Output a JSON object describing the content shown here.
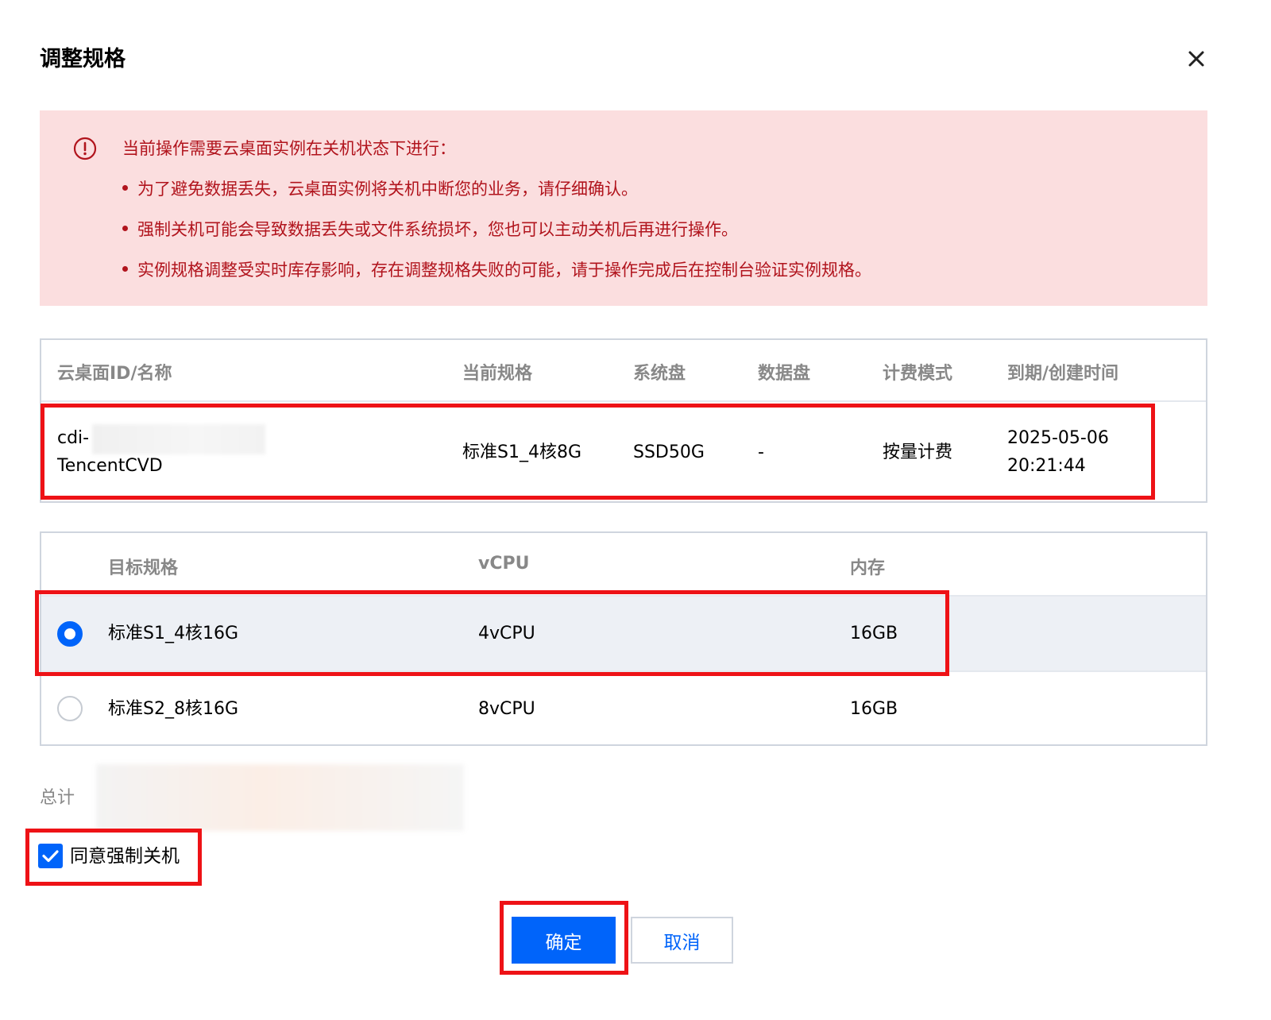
{
  "dialog": {
    "title": "调整规格",
    "close_icon": "close-icon"
  },
  "alert": {
    "color": "#b1141d",
    "background": "#fbdedf",
    "heading": "当前操作需要云桌面实例在关机状态下进行：",
    "items": [
      "为了避免数据丢失，云桌面实例将关机中断您的业务，请仔细确认。",
      "强制关机可能会导致数据丢失或文件系统损坏，您也可以主动关机后再进行操作。",
      "实例规格调整受实时库存影响，存在调整规格失败的可能，请于操作完成后在控制台验证实例规格。"
    ]
  },
  "instance_table": {
    "headers": [
      "云桌面ID/名称",
      "当前规格",
      "系统盘",
      "数据盘",
      "计费模式",
      "到期/创建时间"
    ],
    "row": {
      "id_prefix": "cdi-",
      "name": "TencentCVD",
      "spec": "标准S1_4核8G",
      "system_disk": "SSD50G",
      "data_disk": "-",
      "billing": "按量计费",
      "date": "2025-05-06",
      "time": "20:21:44"
    }
  },
  "spec_table": {
    "headers": [
      "目标规格",
      "vCPU",
      "内存"
    ],
    "rows": [
      {
        "spec": "标准S1_4核16G",
        "vcpu": "4vCPU",
        "memory": "16GB",
        "selected": true
      },
      {
        "spec": "标准S2_8核16G",
        "vcpu": "8vCPU",
        "memory": "16GB",
        "selected": false
      }
    ]
  },
  "total": {
    "label": "总计"
  },
  "agree": {
    "label": "同意强制关机",
    "checked": true
  },
  "buttons": {
    "confirm": "确定",
    "cancel": "取消"
  },
  "colors": {
    "primary": "#0064fa",
    "highlight": "#ee1216"
  }
}
